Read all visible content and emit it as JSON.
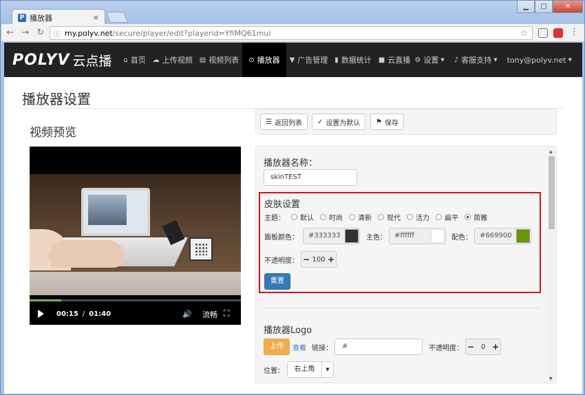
{
  "browser": {
    "tab_title": "播放器",
    "favicon": "P",
    "tab_close": "×",
    "url_host": "my.polyv.net",
    "url_path": "/secure/player/edit?playerid=YfIMQ61mui"
  },
  "nav": {
    "brand": "POLYV",
    "brand_cn": "云点播",
    "items": [
      {
        "label": "首页",
        "icon": "home-icon"
      },
      {
        "label": "上传视频",
        "icon": "upload-icon"
      },
      {
        "label": "视频列表",
        "icon": "film-icon"
      },
      {
        "label": "播放器",
        "icon": "play-circle-icon"
      },
      {
        "label": "广告管理",
        "icon": "filter-icon"
      },
      {
        "label": "数据统计",
        "icon": "bar-chart-icon"
      },
      {
        "label": "云直播",
        "icon": "video-camera-icon"
      }
    ],
    "settings": "设置",
    "support": "客服支持",
    "user": "tony@polyv.net"
  },
  "page": {
    "title": "播放器设置",
    "preview_title": "视频预览"
  },
  "video": {
    "current_time": "00:15",
    "separator": "/",
    "duration": "01:40",
    "quality": "流畅",
    "progress": 0.15
  },
  "toolbar": {
    "back": "返回列表",
    "set_default": "设置为默认",
    "save": "保存"
  },
  "form": {
    "name_label": "播放器名称：",
    "name_value": "skinTEST",
    "skin_title": "皮肤设置",
    "theme_label": "主题：",
    "themes": [
      "默认",
      "时尚",
      "清新",
      "现代",
      "活力",
      "扁平",
      "简雅"
    ],
    "theme_selected": "简雅",
    "panel_color_label": "面板颜色：",
    "panel_color": "#333333",
    "main_color_label": "主色：",
    "main_color": "#ffffff",
    "accent_color_label": "配色：",
    "accent_color": "#669900",
    "opacity_label": "不透明度：",
    "opacity_value": "100",
    "reset": "重置",
    "logo_title": "播放器Logo",
    "upload": "上传",
    "view": "查看",
    "link_label": "链接：",
    "link_value": "#",
    "logo_opacity_label": "不透明度：",
    "logo_opacity_value": "0",
    "position_label": "位置：",
    "position_value": "右上角"
  },
  "colors": {
    "navbar": "#222222",
    "primary": "#337ab7",
    "warning": "#f0ad4e",
    "highlight_border": "#d0121c"
  }
}
